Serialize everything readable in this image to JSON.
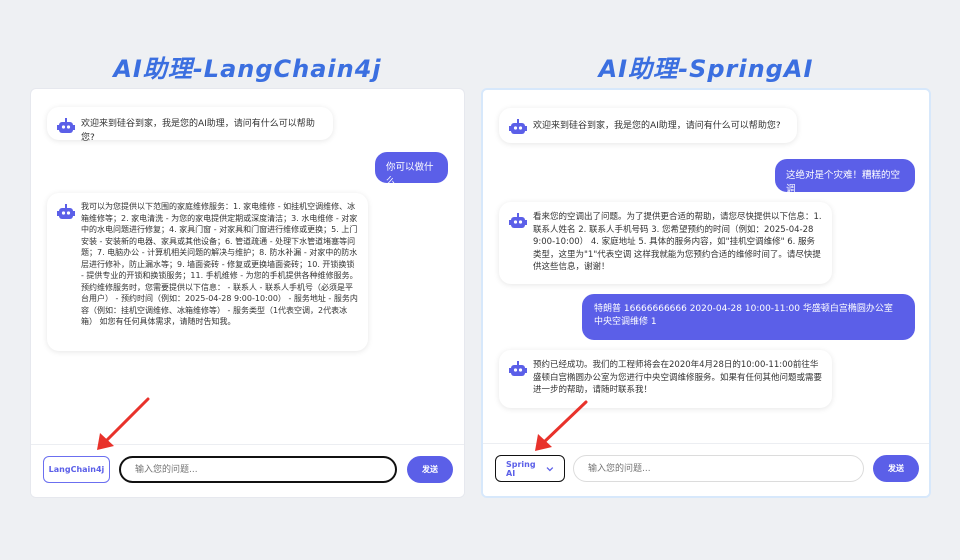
{
  "titles": {
    "left": "AI助理-LangChain4j",
    "right": "AI助理-SpringAI"
  },
  "left": {
    "messages": {
      "bot1": "欢迎来到硅谷到家，我是您的AI助理，请问有什么可以帮助您?",
      "user1": "你可以做什么",
      "bot2": "我可以为您提供以下范围的家庭维修服务：1. 家电维修 - 如挂机空调维修、冰箱维修等；2. 家电清洗 - 为您的家电提供定期或深度清洁；3. 水电维修 - 对家中的水电问题进行修复；4. 家具门窗 - 对家具和门窗进行维修或更换；5. 上门安装 - 安装新的电器、家具或其他设备；6. 管道疏通 - 处理下水管道堵塞等问题；7. 电脑办公 - 计算机相关问题的解决与维护；8. 防水补漏 - 对家中的防水层进行修补，防止漏水等；9. 墙面瓷砖 - 修复或更换墙面瓷砖；10. 开锁换锁 - 提供专业的开锁和换锁服务；11. 手机维修 - 为您的手机提供各种维修服务。 预约维修服务时，您需要提供以下信息： - 联系人 - 联系人手机号（必须是平台用户） - 预约时间（例如：2025-04-28 9:00-10:00） - 服务地址 - 服务内容（例如：挂机空调维修、冰箱维修等） - 服务类型（1代表空调，2代表冰箱） 如您有任何具体需求，请随时告知我。"
    },
    "selector_label": "LangChain4j",
    "input_placeholder": "输入您的问题...",
    "send_label": "发送"
  },
  "right": {
    "messages": {
      "bot1": "欢迎来到硅谷到家，我是您的AI助理，请问有什么可以帮助您?",
      "user1": "这绝对是个灾难！糟糕的空调",
      "bot2": "看来您的空调出了问题。为了提供更合适的帮助，请您尽快提供以下信息：1. 联系人姓名 2. 联系人手机号码 3. 您希望预约的时间（例如：2025-04-28 9:00-10:00） 4. 家庭地址 5. 具体的服务内容，如\"挂机空调维修\" 6. 服务类型，这里为\"1\"代表空调 这样我就能为您预约合适的维修时间了。请尽快提供这些信息，谢谢！",
      "user2": "特朗普 16666666666 2020-04-28 10:00-11:00 华盛顿白宫椭圆办公室 中央空调维修 1",
      "bot3": "预约已经成功。我们的工程师将会在2020年4月28日的10:00-11:00前往华盛顿白宫椭圆办公室为您进行中央空调维修服务。如果有任何其他问题或需要进一步的帮助，请随时联系我！"
    },
    "selector_label": "Spring AI",
    "input_placeholder": "输入您的问题...",
    "send_label": "发送"
  },
  "colors": {
    "accent": "#5b5fe8",
    "title": "#3b6fe0",
    "arrow": "#e8322b"
  },
  "icons": [
    "robot-icon",
    "chevron-down-icon",
    "arrow-annotation"
  ]
}
